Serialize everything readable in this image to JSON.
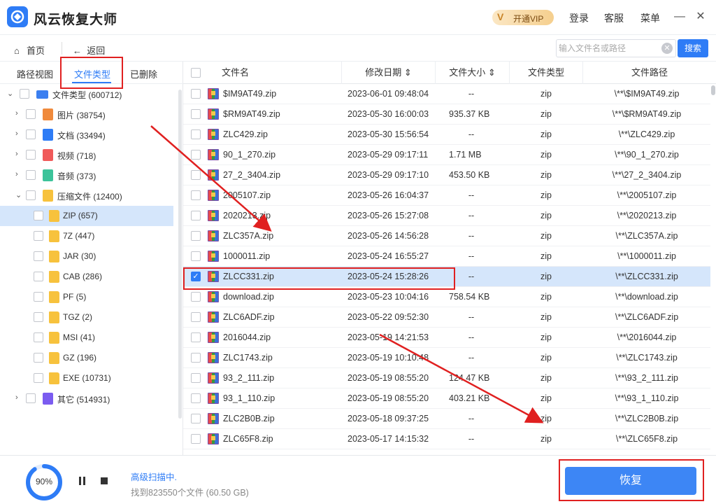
{
  "app": {
    "title": "风云恢复大师",
    "vip_label": "开通VIP",
    "login": "登录",
    "service": "客服",
    "menu": "菜单"
  },
  "nav": {
    "home": "首页",
    "back": "返回",
    "search_placeholder": "输入文件名或路径",
    "search_button": "搜索"
  },
  "left_tabs": [
    "路径视图",
    "文件类型",
    "已删除"
  ],
  "active_left_tab": "文件类型",
  "tree": [
    {
      "label": "文件类型 (600712)",
      "level": 0,
      "icon": "drive-icon",
      "arrow": "expanded"
    },
    {
      "label": "图片 (38754)",
      "level": 1,
      "icon": "image-icon",
      "arrow": "collapsed"
    },
    {
      "label": "文档 (33494)",
      "level": 1,
      "icon": "document-icon",
      "arrow": "collapsed"
    },
    {
      "label": "视频 (718)",
      "level": 1,
      "icon": "video-icon",
      "arrow": "collapsed"
    },
    {
      "label": "音频 (373)",
      "level": 1,
      "icon": "audio-icon",
      "arrow": "collapsed"
    },
    {
      "label": "压缩文件 (12400)",
      "level": 1,
      "icon": "archive-icon",
      "arrow": "expanded"
    },
    {
      "label": "ZIP (657)",
      "level": 2,
      "icon": "folder-icon",
      "selected": true
    },
    {
      "label": "7Z (447)",
      "level": 2,
      "icon": "folder-icon"
    },
    {
      "label": "JAR (30)",
      "level": 2,
      "icon": "folder-icon"
    },
    {
      "label": "CAB (286)",
      "level": 2,
      "icon": "folder-icon"
    },
    {
      "label": "PF (5)",
      "level": 2,
      "icon": "folder-icon"
    },
    {
      "label": "TGZ (2)",
      "level": 2,
      "icon": "folder-icon"
    },
    {
      "label": "MSI (41)",
      "level": 2,
      "icon": "folder-icon"
    },
    {
      "label": "GZ (196)",
      "level": 2,
      "icon": "folder-icon"
    },
    {
      "label": "EXE (10731)",
      "level": 2,
      "icon": "folder-icon"
    },
    {
      "label": "其它 (514931)",
      "level": 1,
      "icon": "other-icon",
      "arrow": "collapsed"
    }
  ],
  "table": {
    "columns": [
      "文件名",
      "修改日期",
      "文件大小",
      "文件类型",
      "文件路径"
    ],
    "sortable": [
      "修改日期",
      "文件大小"
    ],
    "rows": [
      {
        "name": "$IM9AT49.zip",
        "date": "2023-06-01 09:48:04",
        "size": "--",
        "type": "zip",
        "path": "\\**\\$IM9AT49.zip"
      },
      {
        "name": "$RM9AT49.zip",
        "date": "2023-05-30 16:00:03",
        "size": "935.37  KB",
        "type": "zip",
        "path": "\\**\\$RM9AT49.zip"
      },
      {
        "name": "ZLC429.zip",
        "date": "2023-05-30 15:56:54",
        "size": "--",
        "type": "zip",
        "path": "\\**\\ZLC429.zip"
      },
      {
        "name": "90_1_270.zip",
        "date": "2023-05-29 09:17:11",
        "size": "1.71 MB",
        "type": "zip",
        "path": "\\**\\90_1_270.zip"
      },
      {
        "name": "27_2_3404.zip",
        "date": "2023-05-29 09:17:10",
        "size": "453.50  KB",
        "type": "zip",
        "path": "\\**\\27_2_3404.zip"
      },
      {
        "name": "2005107.zip",
        "date": "2023-05-26 16:04:37",
        "size": "--",
        "type": "zip",
        "path": "\\**\\2005107.zip"
      },
      {
        "name": "2020213.zip",
        "date": "2023-05-26 15:27:08",
        "size": "--",
        "type": "zip",
        "path": "\\**\\2020213.zip"
      },
      {
        "name": "ZLC357A.zip",
        "date": "2023-05-26 14:56:28",
        "size": "--",
        "type": "zip",
        "path": "\\**\\ZLC357A.zip"
      },
      {
        "name": "1000011.zip",
        "date": "2023-05-24 16:55:27",
        "size": "--",
        "type": "zip",
        "path": "\\**\\1000011.zip"
      },
      {
        "name": "ZLCC331.zip",
        "date": "2023-05-24 15:28:26",
        "size": "--",
        "type": "zip",
        "path": "\\**\\ZLCC331.zip",
        "checked": true
      },
      {
        "name": "download.zip",
        "date": "2023-05-23 10:04:16",
        "size": "758.54  KB",
        "type": "zip",
        "path": "\\**\\download.zip"
      },
      {
        "name": "ZLC6ADF.zip",
        "date": "2023-05-22 09:52:30",
        "size": "--",
        "type": "zip",
        "path": "\\**\\ZLC6ADF.zip"
      },
      {
        "name": "2016044.zip",
        "date": "2023-05-19 14:21:53",
        "size": "--",
        "type": "zip",
        "path": "\\**\\2016044.zip"
      },
      {
        "name": "ZLC1743.zip",
        "date": "2023-05-19 10:10:48",
        "size": "--",
        "type": "zip",
        "path": "\\**\\ZLC1743.zip"
      },
      {
        "name": "93_2_111.zip",
        "date": "2023-05-19 08:55:20",
        "size": "124.47  KB",
        "type": "zip",
        "path": "\\**\\93_2_111.zip"
      },
      {
        "name": "93_1_110.zip",
        "date": "2023-05-19 08:55:20",
        "size": "403.21  KB",
        "type": "zip",
        "path": "\\**\\93_1_110.zip"
      },
      {
        "name": "ZLC2B0B.zip",
        "date": "2023-05-18 09:37:25",
        "size": "--",
        "type": "zip",
        "path": "\\**\\ZLC2B0B.zip"
      },
      {
        "name": "ZLC65F8.zip",
        "date": "2023-05-17 14:15:32",
        "size": "--",
        "type": "zip",
        "path": "\\**\\ZLC65F8.zip"
      }
    ]
  },
  "scan": {
    "progress_percent": 90,
    "progress_label": "90%",
    "status": "高级扫描中.",
    "found": "找到823550个文件 (60.50 GB)"
  },
  "recover_button": "恢复",
  "colors": {
    "accent": "#2e7cf6",
    "selection": "#d5e6fb",
    "highlight_box": "#e02020"
  }
}
